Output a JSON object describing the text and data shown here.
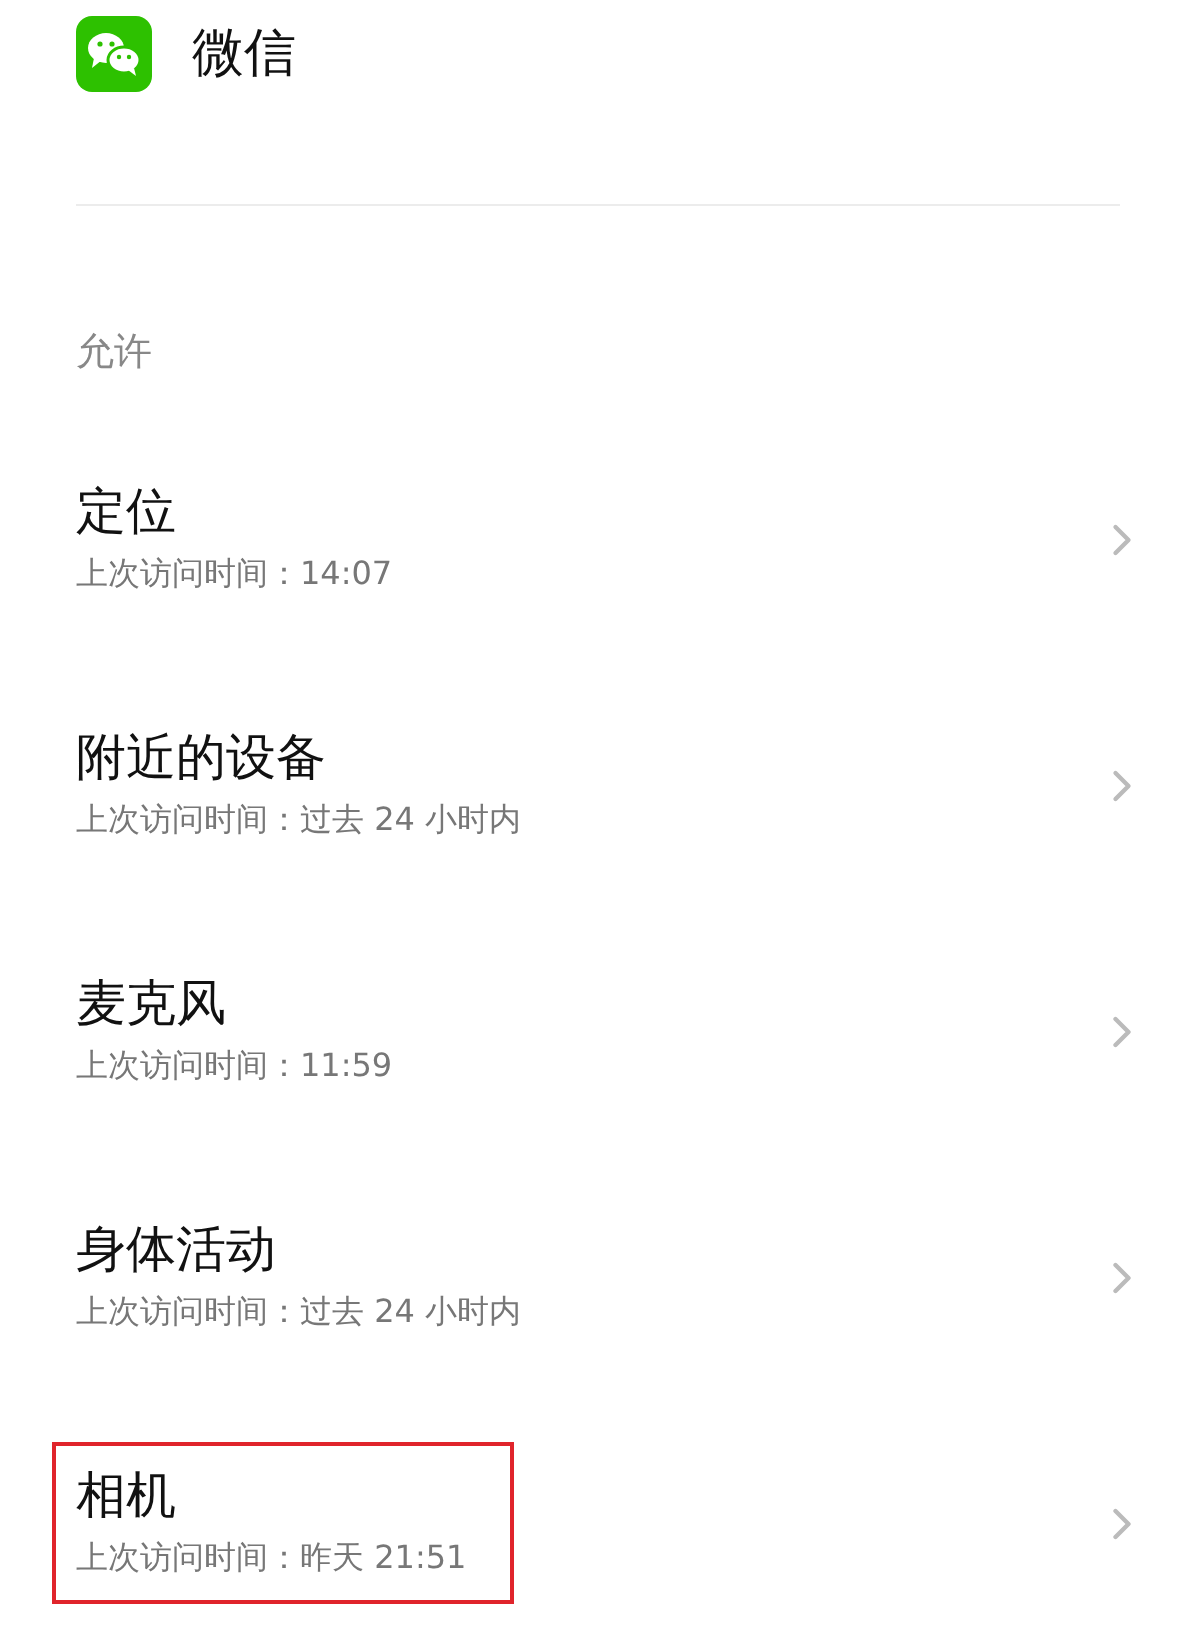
{
  "app": {
    "name": "微信"
  },
  "section": {
    "label": "允许"
  },
  "permissions": [
    {
      "title": "定位",
      "subtitle": "上次访问时间：14:07",
      "highlighted": false
    },
    {
      "title": "附近的设备",
      "subtitle": "上次访问时间：过去 24 小时内",
      "highlighted": false
    },
    {
      "title": "麦克风",
      "subtitle": "上次访问时间：11:59",
      "highlighted": false
    },
    {
      "title": "身体活动",
      "subtitle": "上次访问时间：过去 24 小时内",
      "highlighted": false
    },
    {
      "title": "相机",
      "subtitle": "上次访问时间：昨天 21:51",
      "highlighted": true
    }
  ]
}
